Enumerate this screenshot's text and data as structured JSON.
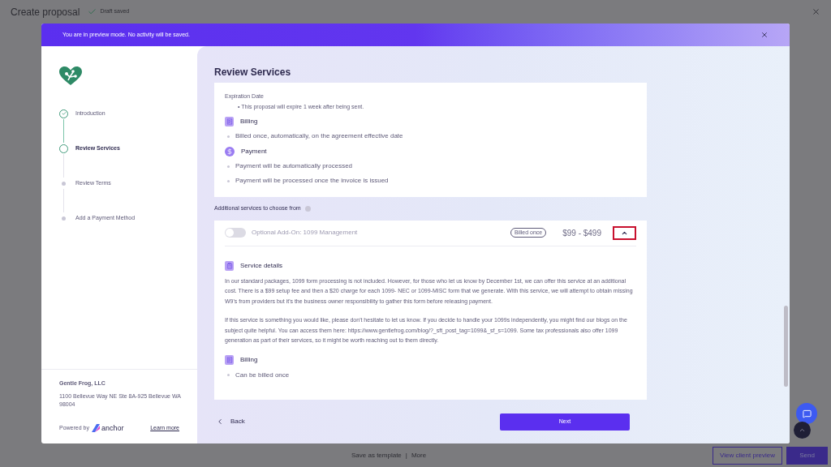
{
  "top_bar": {
    "title": "Create proposal",
    "status": "Draft saved"
  },
  "banner": {
    "text": "You are in preview mode. No activity will be saved."
  },
  "sidebar": {
    "steps": [
      {
        "label": "Introduction",
        "completed": true,
        "selected": false
      },
      {
        "label": "Review Services",
        "completed": false,
        "selected": true
      },
      {
        "label": "Review Terms",
        "completed": false,
        "selected": false
      },
      {
        "label": "Add a Payment Method",
        "completed": false,
        "selected": false
      }
    ],
    "company": {
      "name": "Gentle Frog, LLC",
      "address": "1100 Bellevue Way NE Ste 8A-925 Bellevue WA 98004"
    },
    "powered_by": "Powered by",
    "brand": "anchor",
    "learn_more": "Learn more"
  },
  "main": {
    "title": "Review Services",
    "summary_card": {
      "expiration_label": "Expiration Date",
      "expiration_text": "• This proposal will expire 1 week after being sent.",
      "sections": [
        {
          "kind": "billing",
          "title": "Billing",
          "items": [
            "Billed once, automatically, on the agreement effective date"
          ]
        },
        {
          "kind": "payment",
          "title": "Payment",
          "items": [
            "Payment will be automatically processed",
            "Payment will be processed once the invoice is issued"
          ]
        }
      ]
    },
    "additional_label": "Additional services to choose from",
    "addon": {
      "on": false,
      "expanded": true,
      "name": "Optional Add-On: 1099 Management",
      "badge": "Billed once",
      "price": "$99 - $499",
      "details_title": "Service details",
      "paragraphs": [
        "In our standard packages, 1099 form processing is not included. However, for those who let us know by December 1st, we can offer this service at an additional cost. There is a $99 setup fee and then a $20 charge for each 1099- NEC or 1099-MISC form that we generate. With this service, we will attempt to obtain missing W9's from providers but it's the business owner responsibility to gather this form before releasing payment.",
        "If this service is something you would like, please don't hesitate to let us know. If you decide to handle your 1099s independently, you might find our blogs on the subject quite helpful. You can access them here: https://www.gentlefrog.com/blog/?_sft_post_tag=1099&_sf_s=1099. Some tax professionals also offer 1099 generation as part of their services, so it might be worth reaching out to them directly."
      ],
      "billing_title": "Billing",
      "billing_items": [
        "Can be billed once"
      ]
    },
    "back": "Back",
    "next": "Next"
  },
  "bottom_bar": {
    "save_template": "Save as template",
    "separator": "|",
    "more": "More",
    "preview": "View client preview",
    "send": "Send"
  }
}
